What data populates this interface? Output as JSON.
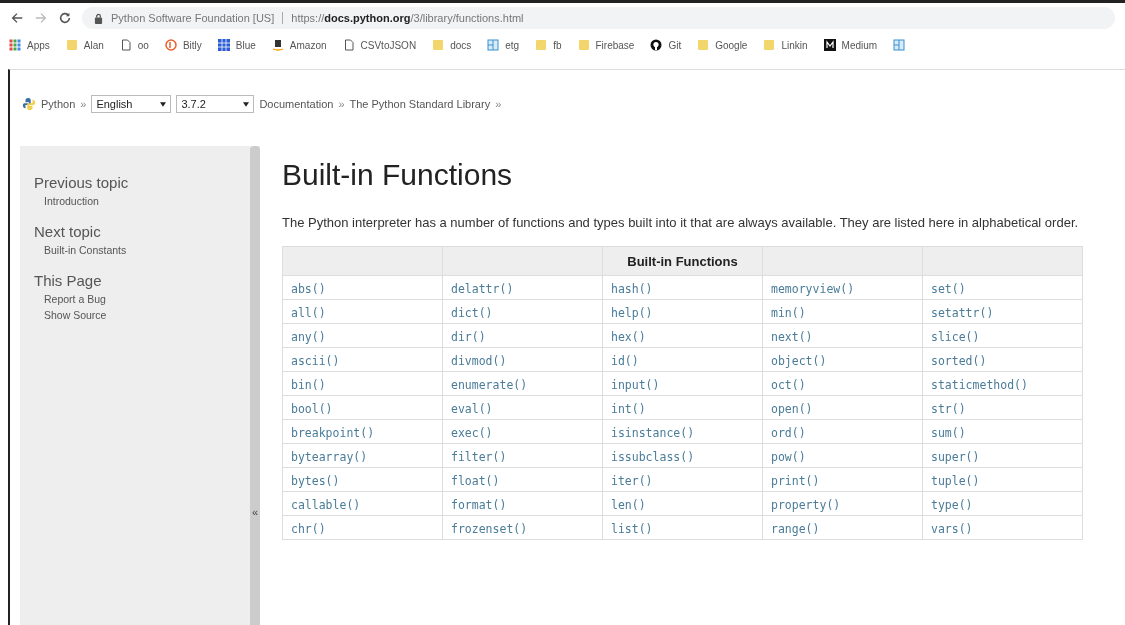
{
  "browser": {
    "site_identity": "Python Software Foundation [US]",
    "url": "https://**docs.python.org**/3/library/functions.html"
  },
  "bookmarks": [
    {
      "label": "Apps",
      "kind": "apps"
    },
    {
      "label": "Alan",
      "kind": "folder"
    },
    {
      "label": "oo",
      "kind": "page"
    },
    {
      "label": "Bitly",
      "kind": "bitly"
    },
    {
      "label": "Blue",
      "kind": "grid"
    },
    {
      "label": "Amazon",
      "kind": "amazon"
    },
    {
      "label": "CSVtoJSON",
      "kind": "page"
    },
    {
      "label": "docs",
      "kind": "folder"
    },
    {
      "label": "etg",
      "kind": "square"
    },
    {
      "label": "fb",
      "kind": "folder"
    },
    {
      "label": "Firebase",
      "kind": "folder"
    },
    {
      "label": "Git",
      "kind": "github"
    },
    {
      "label": "Google",
      "kind": "folder"
    },
    {
      "label": "Linkin",
      "kind": "folder"
    },
    {
      "label": "Medium",
      "kind": "medium"
    },
    {
      "kind": "square"
    }
  ],
  "breadcrumb": {
    "home": "Python",
    "separator": "»",
    "language": "English",
    "version": "3.7.2",
    "links": [
      "Documentation",
      "The Python Standard Library"
    ]
  },
  "sidebar": {
    "sections": [
      {
        "heading": "Previous topic",
        "links": [
          "Introduction"
        ]
      },
      {
        "heading": "Next topic",
        "links": [
          "Built-in Constants"
        ]
      },
      {
        "heading": "This Page",
        "links": [
          "Report a Bug",
          "Show Source"
        ]
      }
    ],
    "collapse_button": "«"
  },
  "page": {
    "title": "Built-in Functions",
    "intro": "The Python interpreter has a number of functions and types built into it that are always available. They are listed here in alphabetical order."
  },
  "table": {
    "heading": "Built-in Functions",
    "rows": [
      [
        "abs()",
        "delattr()",
        "hash()",
        "memoryview()",
        "set()"
      ],
      [
        "all()",
        "dict()",
        "help()",
        "min()",
        "setattr()"
      ],
      [
        "any()",
        "dir()",
        "hex()",
        "next()",
        "slice()"
      ],
      [
        "ascii()",
        "divmod()",
        "id()",
        "object()",
        "sorted()"
      ],
      [
        "bin()",
        "enumerate()",
        "input()",
        "oct()",
        "staticmethod()"
      ],
      [
        "bool()",
        "eval()",
        "int()",
        "open()",
        "str()"
      ],
      [
        "breakpoint()",
        "exec()",
        "isinstance()",
        "ord()",
        "sum()"
      ],
      [
        "bytearray()",
        "filter()",
        "issubclass()",
        "pow()",
        "super()"
      ],
      [
        "bytes()",
        "float()",
        "iter()",
        "print()",
        "tuple()"
      ],
      [
        "callable()",
        "format()",
        "len()",
        "property()",
        "type()"
      ],
      [
        "chr()",
        "frozenset()",
        "list()",
        "range()",
        "vars()"
      ]
    ]
  }
}
